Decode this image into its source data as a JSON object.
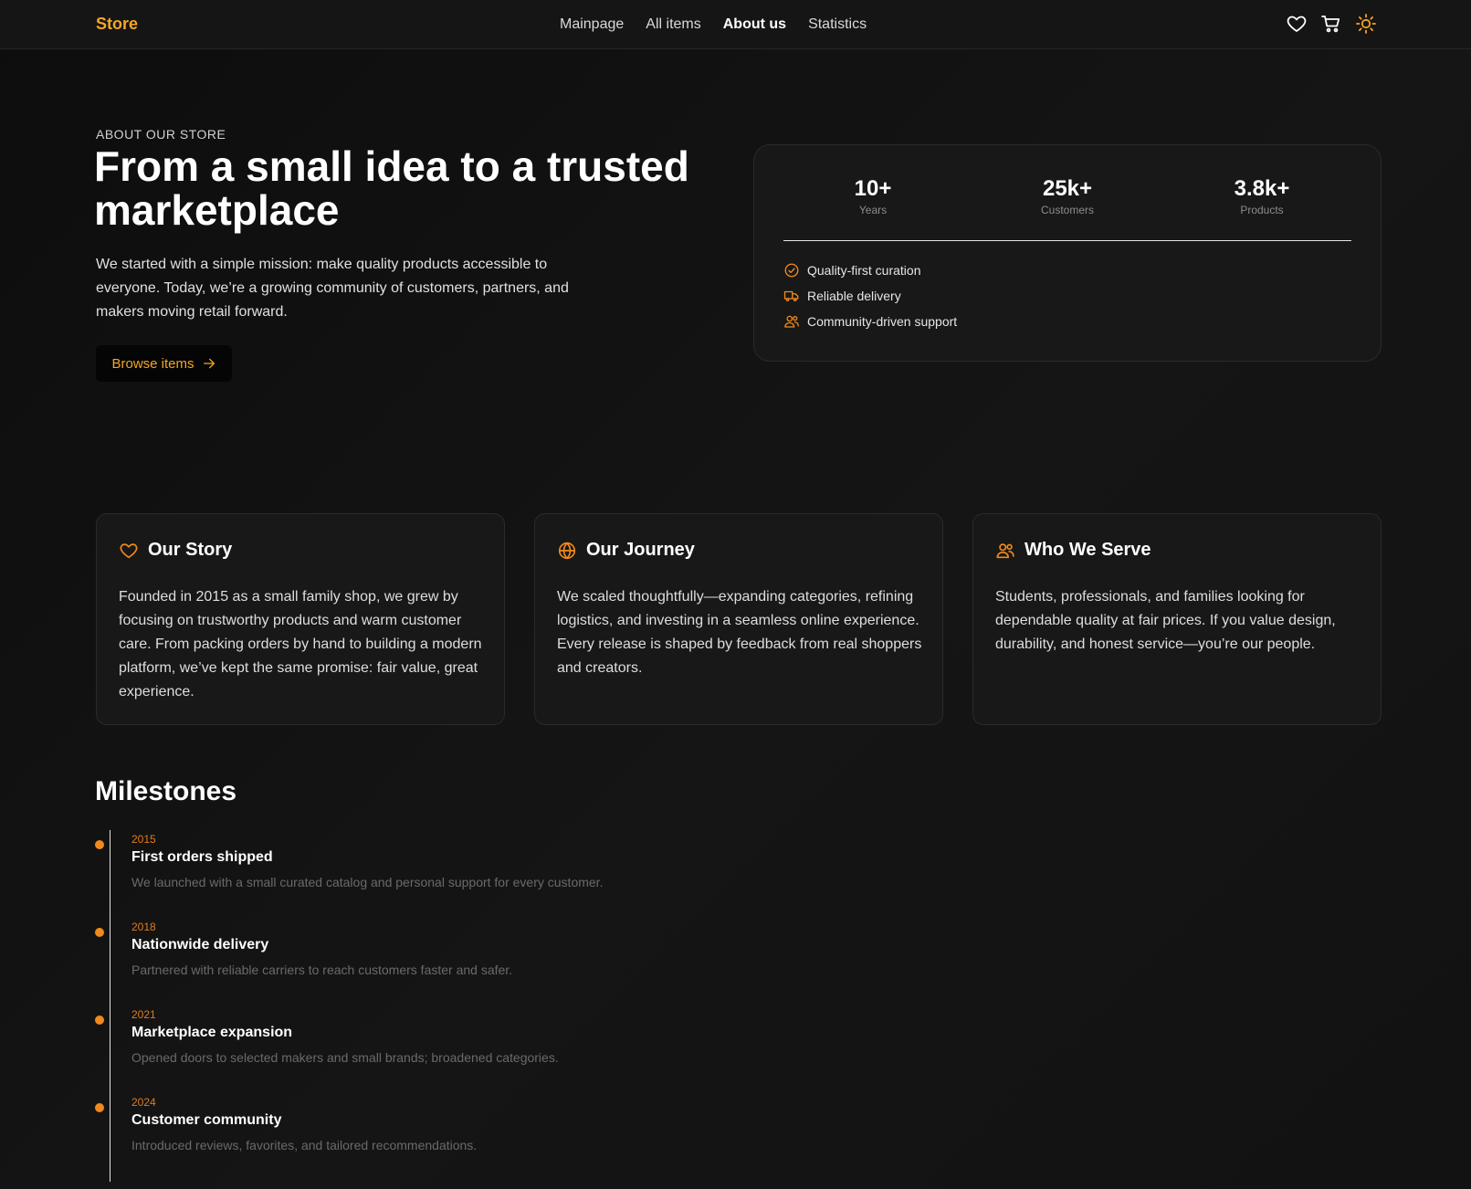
{
  "nav": {
    "brand": "Store",
    "links": [
      {
        "label": "Mainpage",
        "active": false
      },
      {
        "label": "All items",
        "active": false
      },
      {
        "label": "About us",
        "active": true
      },
      {
        "label": "Statistics",
        "active": false
      }
    ],
    "icons": [
      "heart-icon",
      "cart-icon",
      "sun-icon"
    ]
  },
  "hero": {
    "eyebrow": "ABOUT OUR STORE",
    "title": "From a small idea to a trusted marketplace",
    "description": "We started with a simple mission: make quality products accessible to everyone. Today, we’re a growing community of customers, partners, and makers moving retail forward.",
    "cta_label": "Browse items"
  },
  "stats": {
    "items": [
      {
        "value": "10+",
        "label": "Years"
      },
      {
        "value": "25k+",
        "label": "Customers"
      },
      {
        "value": "3.8k+",
        "label": "Products"
      }
    ],
    "features": [
      {
        "icon": "check-circle-icon",
        "label": "Quality-first curation"
      },
      {
        "icon": "truck-icon",
        "label": "Reliable delivery"
      },
      {
        "icon": "users-icon",
        "label": "Community-driven support"
      }
    ]
  },
  "cards": [
    {
      "icon": "heart-icon",
      "title": "Our Story",
      "body": "Founded in 2015 as a small family shop, we grew by focusing on trustworthy products and warm customer care. From packing orders by hand to building a modern platform, we’ve kept the same promise: fair value, great experience."
    },
    {
      "icon": "globe-icon",
      "title": "Our Journey",
      "body": "We scaled thoughtfully—expanding categories, refining logistics, and investing in a seamless online experience. Every release is shaped by feedback from real shoppers and creators."
    },
    {
      "icon": "users-icon",
      "title": "Who We Serve",
      "body": "Students, professionals, and families looking for dependable quality at fair prices. If you value design, durability, and honest service—you’re our people."
    }
  ],
  "milestones": {
    "title": "Milestones",
    "items": [
      {
        "year": "2015",
        "title": "First orders shipped",
        "desc": "We launched with a small curated catalog and personal support for every customer."
      },
      {
        "year": "2018",
        "title": "Nationwide delivery",
        "desc": "Partnered with reliable carriers to reach customers faster and safer."
      },
      {
        "year": "2021",
        "title": "Marketplace expansion",
        "desc": "Opened doors to selected makers and small brands; broadened categories."
      },
      {
        "year": "2024",
        "title": "Customer community",
        "desc": "Introduced reviews, favorites, and tailored recommendations."
      }
    ]
  },
  "colors": {
    "accent": "#f5a623",
    "background": "#121212",
    "card": "#181818"
  }
}
